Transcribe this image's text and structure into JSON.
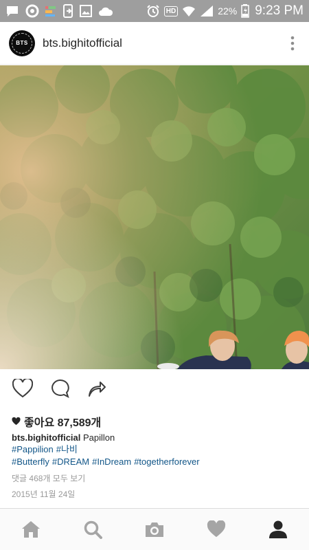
{
  "status_bar": {
    "battery": "22%",
    "time": "9:23 PM",
    "hd_label": "HD",
    "icons": [
      "chat-icon",
      "circle-icon",
      "bars-icon",
      "phone-icon",
      "image-icon",
      "cloud-icon",
      "alarm-icon",
      "hd-icon",
      "wifi-icon",
      "signal-icon",
      "battery-icon"
    ]
  },
  "header": {
    "avatar_text": "BTS",
    "username": "bts.bighitofficial"
  },
  "post": {
    "likes": "좋아요 87,589개",
    "caption_user": "bts.bighitofficial",
    "caption_text": "Papillon",
    "hashtags": [
      "#Pappilion",
      "#나비",
      "#Butterfly",
      "#DREAM",
      "#InDream",
      "#togetherforever"
    ],
    "comments_link": "댓글 468개 모두 보기",
    "date": "2015년 11월 24일"
  },
  "colors": {
    "status_bar": "#9e9e9e",
    "hashtag": "#125688",
    "muted": "#999999",
    "icon": "#a5a5a5"
  },
  "bottom_nav": [
    "home-icon",
    "search-icon",
    "camera-icon",
    "heart-icon",
    "profile-icon"
  ]
}
